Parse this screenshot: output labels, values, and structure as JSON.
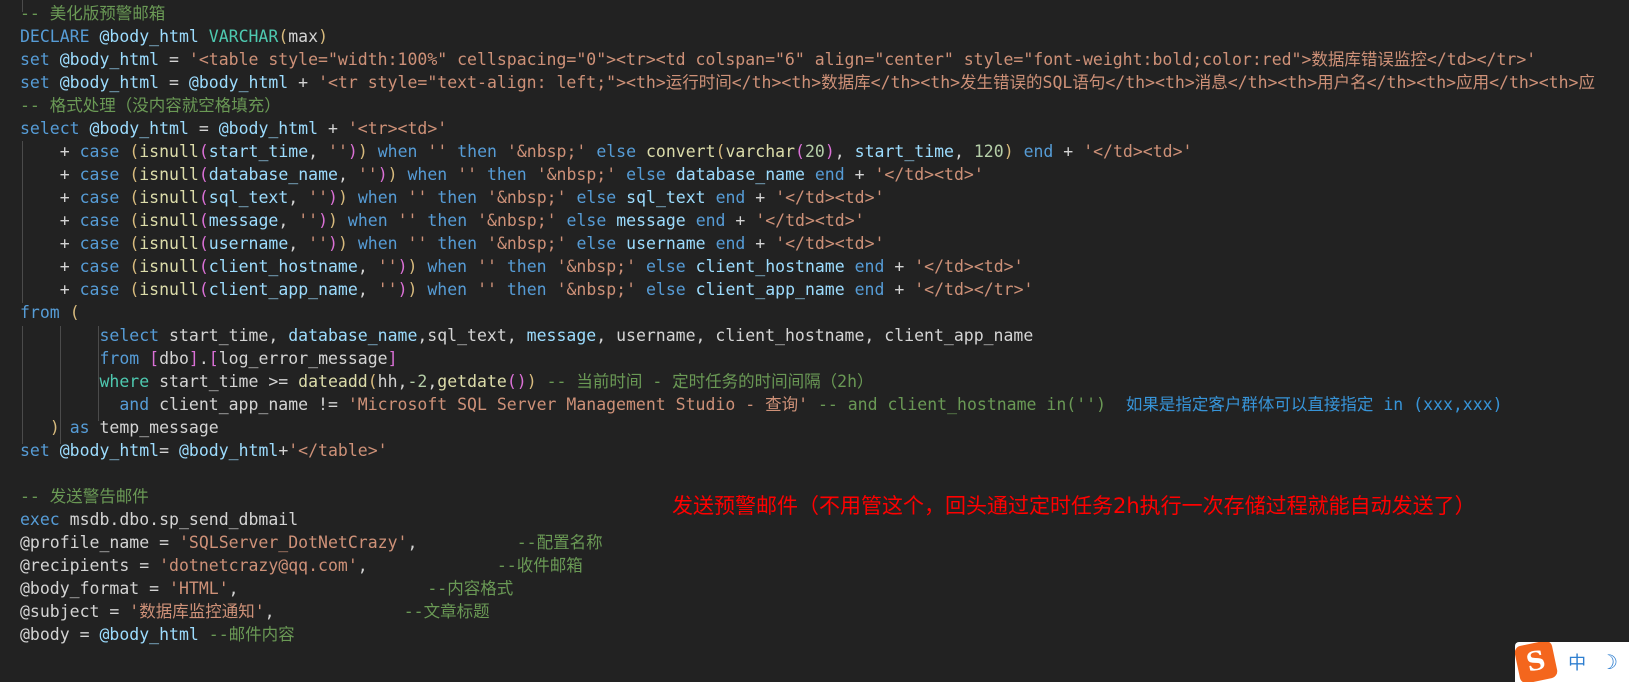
{
  "editor": {
    "theme_background": "#222222",
    "default_text_color": "#d4d4d4",
    "language": "SQL",
    "colors": {
      "keyword": "#569cd6",
      "string": "#ce9178",
      "comment": "#6a9955",
      "function": "#dcdcaa",
      "number": "#b5cea8",
      "identifier": "#9cdcfe",
      "bracket_yellow": "#d7ba7d",
      "bracket_magenta": "#da70d6",
      "bracket_blue": "#179fff",
      "annotation_red": "#ff0000",
      "annotation_blue": "#3794d8"
    }
  },
  "lines": {
    "l01_comment": "-- 美化版预警邮箱",
    "l02_declare_kw": "DECLARE",
    "l02_var": "@body_html",
    "l02_type": "VARCHAR",
    "l02_paren_open": "(",
    "l02_max": "max",
    "l02_paren_close": ")",
    "l03_set": "set",
    "l03_var": "@body_html",
    "l03_eq": " = ",
    "l03_str": "'<table style=\"width:100%\" cellspacing=\"0\"><tr><td colspan=\"6\" align=\"center\" style=\"font-weight:bold;color:red\">数据库错误监控</td></tr>'",
    "l04_set": "set",
    "l04_var": "@body_html",
    "l04_eq": " = ",
    "l04_var2": "@body_html",
    "l04_plus": " + ",
    "l04_str": "'<tr style=\"text-align: left;\"><th>运行时间</th><th>数据库</th><th>发生错误的SQL语句</th><th>消息</th><th>用户名</th><th>应用</th><th>应",
    "l05_comment": "-- 格式处理（没内容就空格填充）",
    "l06_select": "select",
    "l06_var": "@body_html",
    "l06_eq": " = ",
    "l06_var2": "@body_html",
    "l06_plus": " + ",
    "l06_str": "'<tr><td>'",
    "l07_plus": "+ ",
    "l07_case": "case",
    "l07_isnull": "isnull",
    "l07_arg": "start_time",
    "l07_empty": "''",
    "l07_when": "when",
    "l07_then": "then",
    "l07_nbsp": "'&nbsp;'",
    "l07_else": "else",
    "l07_convert": "convert",
    "l07_varchar": "varchar",
    "l07_20": "20",
    "l07_arg2": "start_time",
    "l07_120": "120",
    "l07_end": "end",
    "l07_tail_str": "'</td><td>'",
    "l08_arg": "database_name",
    "l08_else_val": "database_name",
    "l08_tail_str": "'</td><td>'",
    "l09_arg": "sql_text",
    "l09_else_val": "sql_text",
    "l09_tail_str": "'</td><td>'",
    "l10_arg": "message",
    "l10_else_val": "message",
    "l10_tail_str": "'</td><td>'",
    "l11_arg": "username",
    "l11_else_val": "username",
    "l11_tail_str": "'</td><td>'",
    "l12_arg": "client_hostname",
    "l12_else_val": "client_hostname",
    "l12_tail_str": "'</td><td>'",
    "l13_arg": "client_app_name",
    "l13_else_val": "client_app_name",
    "l13_tail_str": "'</td></tr>'",
    "l14_from": "from",
    "l14_paren": "(",
    "l15_select": "select",
    "l15_cols_a": " start_time, ",
    "l15_cols_b": "database_name",
    "l15_cols_c": ",sql_text, ",
    "l15_cols_d": "message",
    "l15_cols_e": ", username, client_hostname, client_app_name",
    "l16_from": "from",
    "l16_sp": " ",
    "l16_brk1": "[",
    "l16_dbo": "dbo",
    "l16_brk2": "]",
    "l16_dot": ".",
    "l16_brk3": "[",
    "l16_tbl": "log_error_message",
    "l16_brk4": "]",
    "l17_where": "where",
    "l17_col": " start_time >= ",
    "l17_fn": "dateadd",
    "l17_p1": "(",
    "l17_hh": "hh,",
    "l17_neg2": "-2",
    "l17_comma": ",",
    "l17_getdate": "getdate",
    "l17_p2": "()",
    "l17_p3": ")",
    "l17_comment": "-- 当前时间 - 定时任务的时间间隔（2h）",
    "l18_and": "and",
    "l18_col": " client_app_name != ",
    "l18_str": "'Microsoft SQL Server Management Studio - 查询'",
    "l18_comment": "-- and client_hostname in('')",
    "l18_bluenote": "如果是指定客户群体可以直接指定 in (xxx,xxx)",
    "l19_paren": ")",
    "l19_as": "as",
    "l19_alias": "temp_message",
    "l20_set": "set",
    "l20_var": "@body_html",
    "l20_eq": "= ",
    "l20_var2": "@body_html",
    "l20_plus": "+",
    "l20_str": "'</table>'",
    "l21_blank": "",
    "l22_comment": "-- 发送警告邮件",
    "l23_exec": "exec",
    "l23_proc": " msdb.dbo.sp_send_dbmail",
    "l24_param": "@profile_name",
    "l24_eq": " = ",
    "l24_str": "'SQLServer_DotNetCrazy'",
    "l24_comma": ",",
    "l24_comment": "--配置名称",
    "l25_param": "@recipients",
    "l25_eq": " = ",
    "l25_str": "'dotnetcrazy@qq.com'",
    "l25_comma": ",",
    "l25_comment": "--收件邮箱",
    "l26_param": "@body_format",
    "l26_eq": " = ",
    "l26_str": "'HTML'",
    "l26_comma": ",",
    "l26_comment": "--内容格式",
    "l27_param": "@subject",
    "l27_eq": " = ",
    "l27_str": "'数据库监控通知'",
    "l27_comma": ",",
    "l27_comment": "--文章标题",
    "l28_param": "@body",
    "l28_eq": " = ",
    "l28_var": "@body_html",
    "l28_comment": "--邮件内容"
  },
  "shared_tokens": {
    "plus": "+ ",
    "case": "case",
    "isnull": "isnull",
    "when": "when",
    "then": "then",
    "else": "else",
    "end": "end",
    "empty_str": "''",
    "nbsp_str": "'&nbsp;'",
    "paren_open": "(",
    "paren_close": ")",
    "comma_space": ", ",
    "plus_space": " + "
  },
  "annotations": {
    "red_note": "发送预警邮件（不用管这个，回头通过定时任务2h执行一次存储过程就能自动发送了）"
  },
  "ime_bar": {
    "logo": "S",
    "mode_label": "中",
    "moon_glyph": "☽"
  }
}
